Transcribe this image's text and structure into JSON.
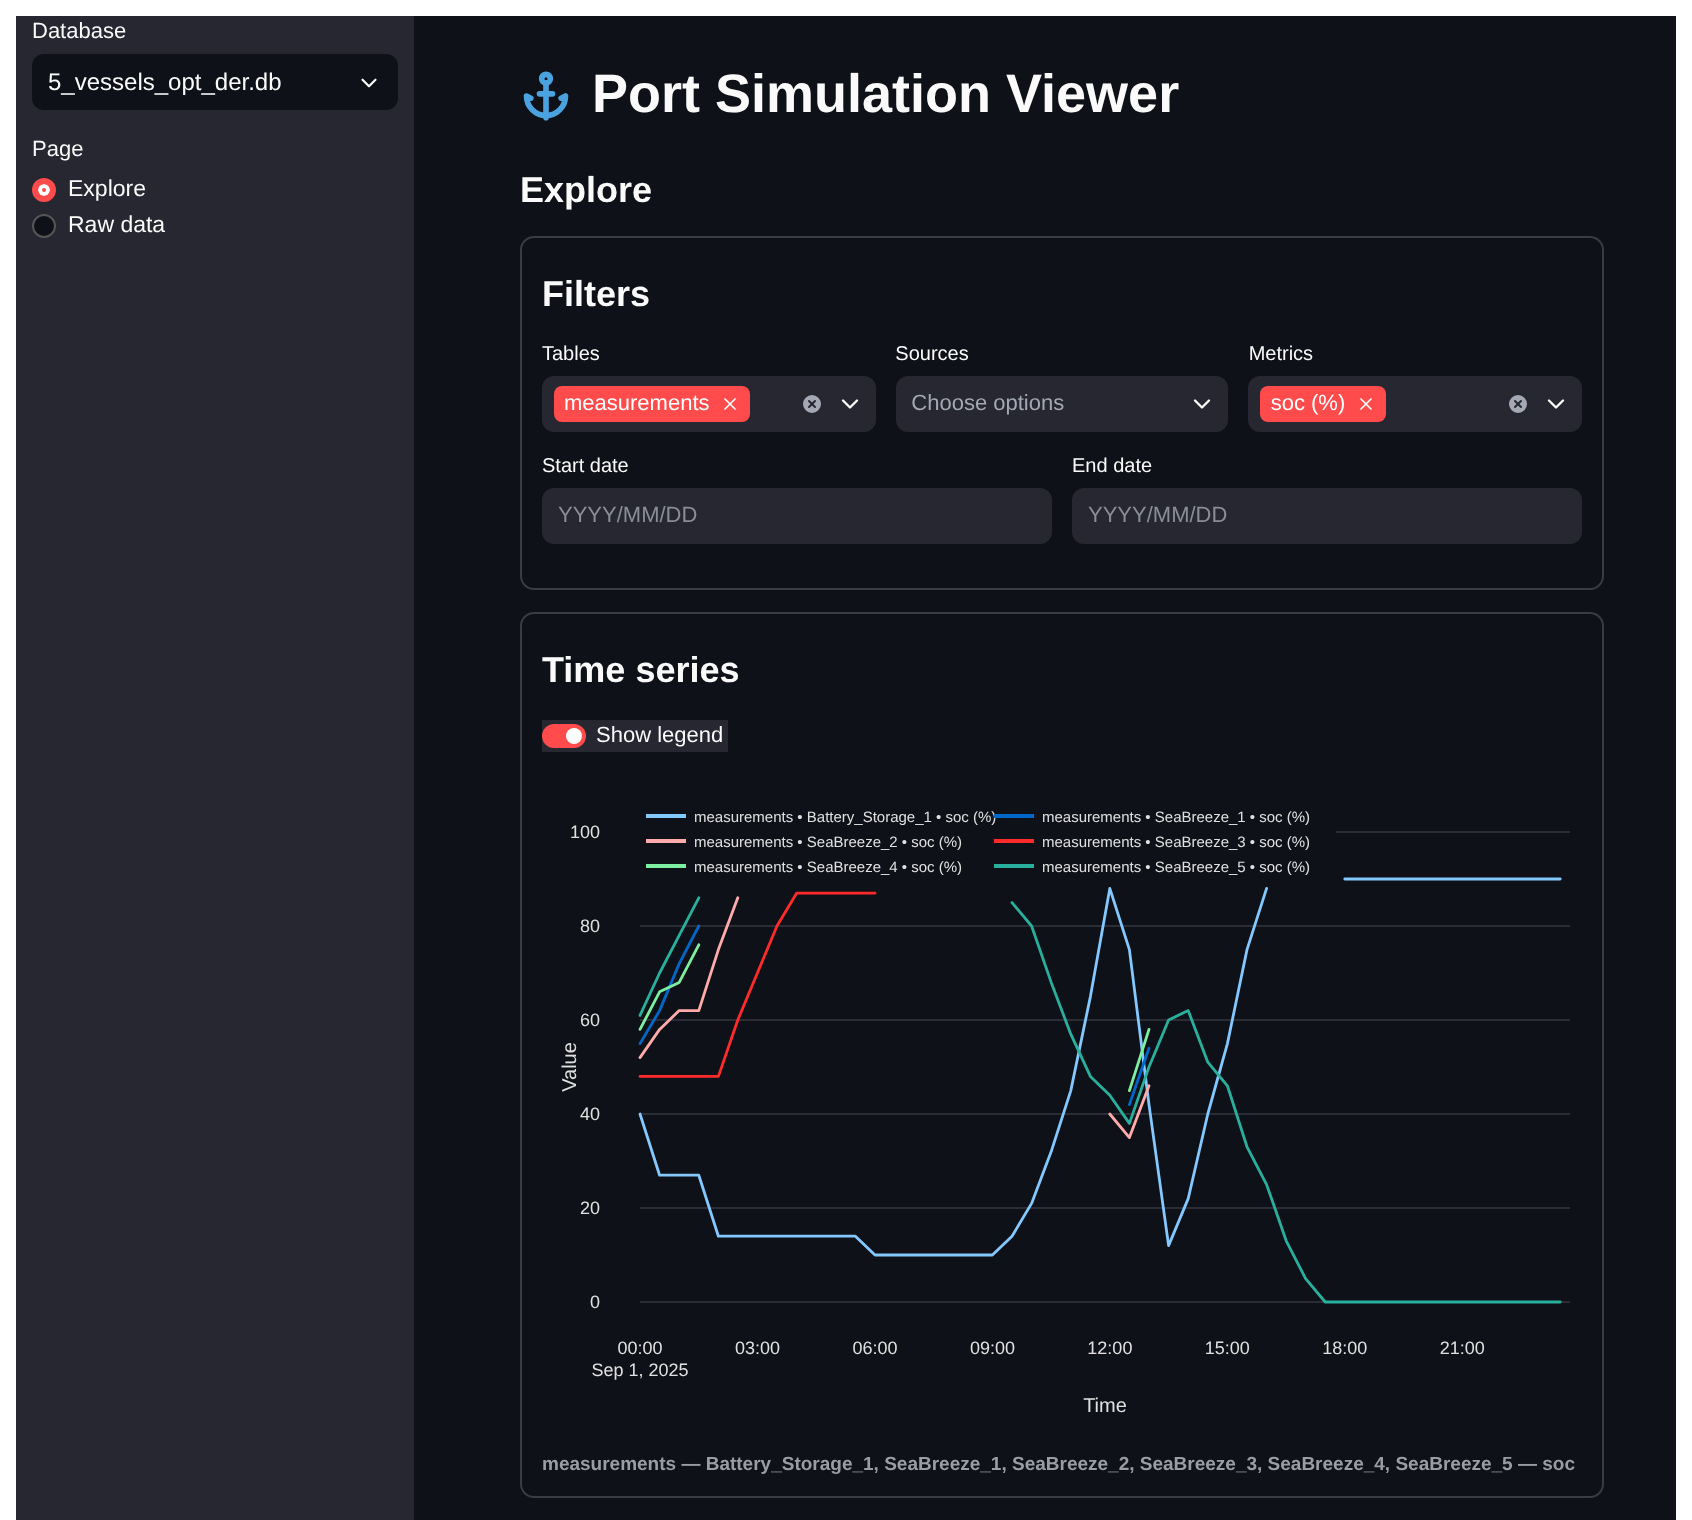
{
  "sidebar": {
    "database": {
      "label": "Database",
      "value": "5_vessels_opt_der.db"
    },
    "page": {
      "label": "Page",
      "options": [
        {
          "label": "Explore",
          "selected": true
        },
        {
          "label": "Raw data",
          "selected": false
        }
      ]
    }
  },
  "title": "Port Simulation Viewer",
  "section": "Explore",
  "filters": {
    "title": "Filters",
    "selects": [
      {
        "label": "Tables",
        "tags": [
          "measurements"
        ]
      },
      {
        "label": "Sources",
        "placeholder": "Choose options"
      },
      {
        "label": "Metrics",
        "tags": [
          "soc (%)"
        ]
      }
    ],
    "dates": [
      {
        "label": "Start date",
        "placeholder": "YYYY/MM/DD"
      },
      {
        "label": "End date",
        "placeholder": "YYYY/MM/DD"
      }
    ]
  },
  "timeseries": {
    "title": "Time series",
    "legend_toggle": {
      "label": "Show legend",
      "on": true
    },
    "date_label": "Sep 1, 2025",
    "chart_data": {
      "type": "line",
      "xlabel": "Time",
      "ylabel": "Value",
      "x": [
        0,
        0.5,
        1,
        1.5,
        2,
        2.5,
        3,
        3.5,
        4,
        4.5,
        5,
        5.5,
        6,
        6.5,
        7,
        7.5,
        8,
        8.5,
        9,
        9.5,
        10,
        10.5,
        11,
        11.5,
        12,
        12.5,
        13,
        13.5,
        14,
        14.5,
        15,
        15.5,
        16,
        16.5,
        17,
        17.5,
        18,
        18.5,
        19,
        19.5,
        20,
        20.5,
        21,
        21.5,
        22,
        22.5,
        23,
        23.5
      ],
      "xlim": [
        0,
        23.75
      ],
      "ylim": [
        0,
        100
      ],
      "grid": true,
      "legend": true,
      "xticks": [
        {
          "value": 0,
          "label": "00:00"
        },
        {
          "value": 3,
          "label": "03:00"
        },
        {
          "value": 6,
          "label": "06:00"
        },
        {
          "value": 9,
          "label": "09:00"
        },
        {
          "value": 12,
          "label": "12:00"
        },
        {
          "value": 15,
          "label": "15:00"
        },
        {
          "value": 18,
          "label": "18:00"
        },
        {
          "value": 21,
          "label": "21:00"
        }
      ],
      "yticks": [
        0,
        20,
        40,
        60,
        80,
        100
      ],
      "series": [
        {
          "name": "measurements • Battery_Storage_1 • soc (%)",
          "color": "#83c9ff",
          "values": [
            40,
            27,
            27,
            27,
            14,
            14,
            14,
            14,
            14,
            14,
            14,
            14,
            10,
            10,
            10,
            10,
            10,
            10,
            10,
            14,
            21,
            32,
            45,
            65,
            88,
            75,
            42,
            12,
            22,
            40,
            55,
            75,
            88,
            null,
            null,
            null,
            90,
            90,
            90,
            90,
            90,
            90,
            90,
            90,
            90,
            90,
            90,
            90
          ]
        },
        {
          "name": "measurements • SeaBreeze_1 • soc (%)",
          "color": "#0068c9",
          "values": [
            55,
            62,
            72,
            80,
            null,
            null,
            null,
            null,
            null,
            null,
            null,
            null,
            null,
            null,
            null,
            null,
            null,
            null,
            null,
            null,
            null,
            null,
            null,
            null,
            null,
            42,
            54,
            null,
            null,
            null,
            null,
            null,
            null,
            null,
            null,
            null,
            null,
            null,
            null,
            null,
            null,
            null,
            null,
            null,
            null,
            null,
            null,
            null
          ]
        },
        {
          "name": "measurements • SeaBreeze_2 • soc (%)",
          "color": "#ffabab",
          "values": [
            52,
            58,
            62,
            62,
            75,
            86,
            null,
            null,
            null,
            null,
            null,
            null,
            null,
            null,
            null,
            null,
            null,
            null,
            null,
            null,
            null,
            null,
            null,
            null,
            40,
            35,
            46,
            null,
            null,
            null,
            null,
            null,
            null,
            null,
            null,
            null,
            null,
            null,
            null,
            null,
            null,
            null,
            null,
            null,
            null,
            null,
            null,
            null
          ]
        },
        {
          "name": "measurements • SeaBreeze_3 • soc (%)",
          "color": "#ff2b2b",
          "values": [
            48,
            48,
            48,
            48,
            48,
            60,
            70,
            80,
            87,
            87,
            87,
            87,
            87,
            null,
            null,
            null,
            null,
            null,
            null,
            null,
            null,
            null,
            null,
            null,
            null,
            null,
            null,
            null,
            null,
            null,
            null,
            null,
            null,
            null,
            null,
            null,
            null,
            null,
            null,
            null,
            null,
            null,
            null,
            null,
            null,
            null,
            null,
            null
          ]
        },
        {
          "name": "measurements • SeaBreeze_4 • soc (%)",
          "color": "#7defa1",
          "values": [
            58,
            66,
            68,
            76,
            null,
            null,
            null,
            null,
            null,
            null,
            null,
            null,
            null,
            null,
            null,
            null,
            null,
            null,
            null,
            null,
            null,
            null,
            null,
            null,
            null,
            45,
            58,
            null,
            null,
            null,
            null,
            null,
            null,
            null,
            null,
            null,
            null,
            null,
            null,
            null,
            null,
            null,
            null,
            null,
            null,
            null,
            null,
            null
          ]
        },
        {
          "name": "measurements • SeaBreeze_5 • soc (%)",
          "color": "#29b09d",
          "values": [
            61,
            70,
            78,
            86,
            null,
            null,
            null,
            null,
            null,
            null,
            null,
            null,
            null,
            null,
            null,
            null,
            null,
            null,
            null,
            85,
            80,
            68,
            57,
            48,
            44,
            38,
            50,
            60,
            62,
            51,
            46,
            33,
            25,
            13,
            5,
            0,
            0,
            0,
            0,
            0,
            0,
            0,
            0,
            0,
            0,
            0,
            0,
            0
          ]
        }
      ]
    },
    "caption": "measurements — Battery_Storage_1, SeaBreeze_1, SeaBreeze_2, SeaBreeze_3, SeaBreeze_4, SeaBreeze_5 — soc"
  }
}
